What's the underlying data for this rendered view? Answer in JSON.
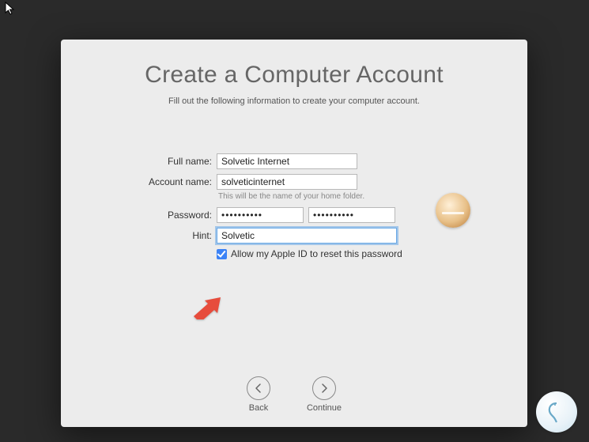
{
  "title": "Create a Computer Account",
  "subtitle": "Fill out the following information to create your computer account.",
  "labels": {
    "full_name": "Full name:",
    "account_name": "Account name:",
    "password": "Password:",
    "hint": "Hint:"
  },
  "values": {
    "full_name": "Solvetic Internet",
    "account_name": "solveticinternet",
    "password": "••••••••••",
    "password_verify": "••••••••••",
    "hint": "Solvetic"
  },
  "helper": {
    "account_name": "This will be the name of your home folder."
  },
  "checkbox": {
    "allow_apple_id": "Allow my Apple ID to reset this password",
    "checked": true
  },
  "nav": {
    "back": "Back",
    "continue": "Continue"
  }
}
